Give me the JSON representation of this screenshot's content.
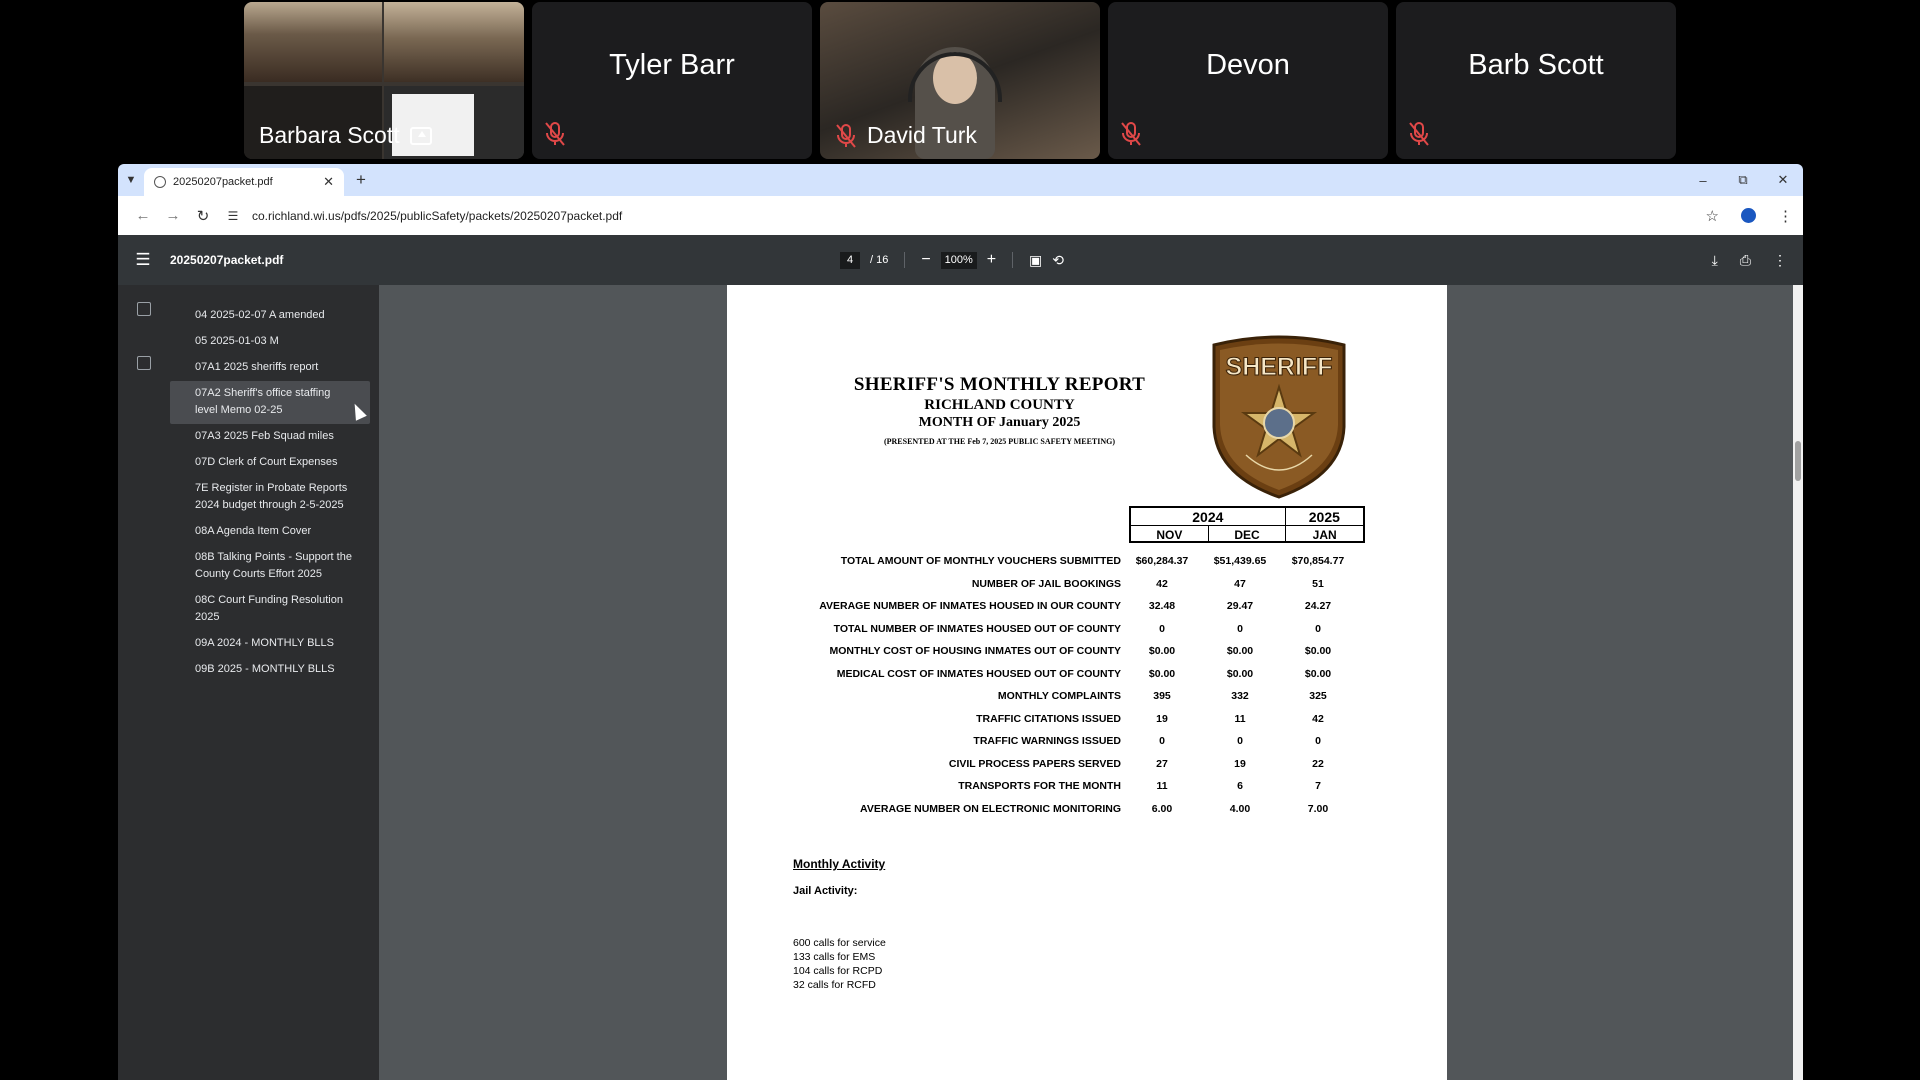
{
  "meeting": {
    "tiles": [
      {
        "name": "Barbara Scott",
        "type": "video-share"
      },
      {
        "name": "Tyler Barr",
        "type": "avatar",
        "muted": true
      },
      {
        "name": "David Turk",
        "type": "video",
        "muted": true
      },
      {
        "name": "Devon",
        "type": "avatar",
        "muted": true
      },
      {
        "name": "Barb Scott",
        "type": "avatar",
        "muted": true
      }
    ]
  },
  "browser": {
    "tab_title": "20250207packet.pdf",
    "url": "co.richland.wi.us/pdfs/2025/publicSafety/packets/20250207packet.pdf",
    "new_tab": "+"
  },
  "pdf": {
    "title": "20250207packet.pdf",
    "page_current": "4",
    "page_total": "/ 16",
    "zoom": "100%",
    "outline": [
      "04 2025-02-07 A amended",
      "05 2025-01-03 M",
      "07A1 2025 sheriffs report",
      "07A2 Sheriff's office staffing level Memo 02-25",
      "07A3 2025 Feb Squad miles",
      "07D Clerk of Court Expenses",
      "7E Register in Probate Reports 2024 budget through 2-5-2025",
      "08A Agenda Item Cover",
      "08B Talking Points - Support the County Courts Effort 2025",
      "08C Court Funding Resolution 2025",
      "09A 2024 - MONTHLY BLLS",
      "09B 2025 - MONTHLY BLLS"
    ],
    "selected_outline_index": 3
  },
  "report": {
    "title": "SHERIFF'S MONTHLY REPORT",
    "county": "RICHLAND COUNTY",
    "month": "MONTH OF January 2025",
    "presented": "(PRESENTED AT THE Feb 7, 2025 PUBLIC SAFETY MEETING)",
    "badge_text": "SHERIFF",
    "badge_ring": "RICHLAND COUNTY",
    "years": [
      "2024",
      "2025"
    ],
    "months": [
      "NOV",
      "DEC",
      "JAN"
    ],
    "rows": [
      {
        "label": "TOTAL AMOUNT OF MONTHLY VOUCHERS SUBMITTED",
        "values": [
          "$60,284.37",
          "$51,439.65",
          "$70,854.77"
        ]
      },
      {
        "label": "NUMBER OF JAIL BOOKINGS",
        "values": [
          "42",
          "47",
          "51"
        ]
      },
      {
        "label": "AVERAGE NUMBER OF INMATES HOUSED IN OUR COUNTY",
        "values": [
          "32.48",
          "29.47",
          "24.27"
        ]
      },
      {
        "label": "TOTAL NUMBER OF INMATES HOUSED OUT OF COUNTY",
        "values": [
          "0",
          "0",
          "0"
        ]
      },
      {
        "label": "MONTHLY COST OF HOUSING INMATES OUT OF COUNTY",
        "values": [
          "$0.00",
          "$0.00",
          "$0.00"
        ]
      },
      {
        "label": "MEDICAL COST OF INMATES HOUSED OUT OF COUNTY",
        "values": [
          "$0.00",
          "$0.00",
          "$0.00"
        ]
      },
      {
        "label": "MONTHLY COMPLAINTS",
        "values": [
          "395",
          "332",
          "325"
        ]
      },
      {
        "label": "TRAFFIC CITATIONS ISSUED",
        "values": [
          "19",
          "11",
          "42"
        ]
      },
      {
        "label": "TRAFFIC WARNINGS ISSUED",
        "values": [
          "0",
          "0",
          "0"
        ]
      },
      {
        "label": "CIVIL PROCESS PAPERS SERVED",
        "values": [
          "27",
          "19",
          "22"
        ]
      },
      {
        "label": "TRANSPORTS FOR THE MONTH",
        "values": [
          "11",
          "6",
          "7"
        ]
      },
      {
        "label": "AVERAGE NUMBER ON ELECTRONIC MONITORING",
        "values": [
          "6.00",
          "4.00",
          "7.00"
        ]
      }
    ],
    "activity_heading": "Monthly Activity",
    "jail_heading": "Jail Activity:",
    "calls": [
      "600 calls for service",
      "133 calls for EMS",
      "104 calls for RCPD",
      "32 calls for RCFD"
    ]
  },
  "colors": {
    "toolbar": "#323639",
    "sidebar": "#2c2d2f",
    "viewer_bg": "#525659",
    "tabbar": "#d3e3fd",
    "mute_red": "#e04848"
  }
}
